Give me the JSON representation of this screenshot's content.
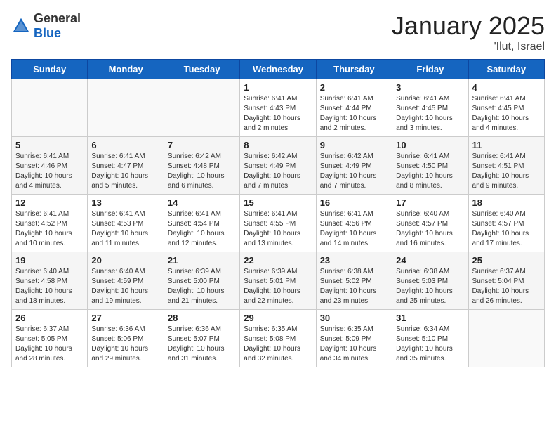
{
  "header": {
    "title": "January 2025",
    "location": "'Ilut, Israel",
    "logo_general": "General",
    "logo_blue": "Blue"
  },
  "days_of_week": [
    "Sunday",
    "Monday",
    "Tuesday",
    "Wednesday",
    "Thursday",
    "Friday",
    "Saturday"
  ],
  "weeks": [
    [
      {
        "day": "",
        "info": ""
      },
      {
        "day": "",
        "info": ""
      },
      {
        "day": "",
        "info": ""
      },
      {
        "day": "1",
        "info": "Sunrise: 6:41 AM\nSunset: 4:43 PM\nDaylight: 10 hours\nand 2 minutes."
      },
      {
        "day": "2",
        "info": "Sunrise: 6:41 AM\nSunset: 4:44 PM\nDaylight: 10 hours\nand 2 minutes."
      },
      {
        "day": "3",
        "info": "Sunrise: 6:41 AM\nSunset: 4:45 PM\nDaylight: 10 hours\nand 3 minutes."
      },
      {
        "day": "4",
        "info": "Sunrise: 6:41 AM\nSunset: 4:45 PM\nDaylight: 10 hours\nand 4 minutes."
      }
    ],
    [
      {
        "day": "5",
        "info": "Sunrise: 6:41 AM\nSunset: 4:46 PM\nDaylight: 10 hours\nand 4 minutes."
      },
      {
        "day": "6",
        "info": "Sunrise: 6:41 AM\nSunset: 4:47 PM\nDaylight: 10 hours\nand 5 minutes."
      },
      {
        "day": "7",
        "info": "Sunrise: 6:42 AM\nSunset: 4:48 PM\nDaylight: 10 hours\nand 6 minutes."
      },
      {
        "day": "8",
        "info": "Sunrise: 6:42 AM\nSunset: 4:49 PM\nDaylight: 10 hours\nand 7 minutes."
      },
      {
        "day": "9",
        "info": "Sunrise: 6:42 AM\nSunset: 4:49 PM\nDaylight: 10 hours\nand 7 minutes."
      },
      {
        "day": "10",
        "info": "Sunrise: 6:41 AM\nSunset: 4:50 PM\nDaylight: 10 hours\nand 8 minutes."
      },
      {
        "day": "11",
        "info": "Sunrise: 6:41 AM\nSunset: 4:51 PM\nDaylight: 10 hours\nand 9 minutes."
      }
    ],
    [
      {
        "day": "12",
        "info": "Sunrise: 6:41 AM\nSunset: 4:52 PM\nDaylight: 10 hours\nand 10 minutes."
      },
      {
        "day": "13",
        "info": "Sunrise: 6:41 AM\nSunset: 4:53 PM\nDaylight: 10 hours\nand 11 minutes."
      },
      {
        "day": "14",
        "info": "Sunrise: 6:41 AM\nSunset: 4:54 PM\nDaylight: 10 hours\nand 12 minutes."
      },
      {
        "day": "15",
        "info": "Sunrise: 6:41 AM\nSunset: 4:55 PM\nDaylight: 10 hours\nand 13 minutes."
      },
      {
        "day": "16",
        "info": "Sunrise: 6:41 AM\nSunset: 4:56 PM\nDaylight: 10 hours\nand 14 minutes."
      },
      {
        "day": "17",
        "info": "Sunrise: 6:40 AM\nSunset: 4:57 PM\nDaylight: 10 hours\nand 16 minutes."
      },
      {
        "day": "18",
        "info": "Sunrise: 6:40 AM\nSunset: 4:57 PM\nDaylight: 10 hours\nand 17 minutes."
      }
    ],
    [
      {
        "day": "19",
        "info": "Sunrise: 6:40 AM\nSunset: 4:58 PM\nDaylight: 10 hours\nand 18 minutes."
      },
      {
        "day": "20",
        "info": "Sunrise: 6:40 AM\nSunset: 4:59 PM\nDaylight: 10 hours\nand 19 minutes."
      },
      {
        "day": "21",
        "info": "Sunrise: 6:39 AM\nSunset: 5:00 PM\nDaylight: 10 hours\nand 21 minutes."
      },
      {
        "day": "22",
        "info": "Sunrise: 6:39 AM\nSunset: 5:01 PM\nDaylight: 10 hours\nand 22 minutes."
      },
      {
        "day": "23",
        "info": "Sunrise: 6:38 AM\nSunset: 5:02 PM\nDaylight: 10 hours\nand 23 minutes."
      },
      {
        "day": "24",
        "info": "Sunrise: 6:38 AM\nSunset: 5:03 PM\nDaylight: 10 hours\nand 25 minutes."
      },
      {
        "day": "25",
        "info": "Sunrise: 6:37 AM\nSunset: 5:04 PM\nDaylight: 10 hours\nand 26 minutes."
      }
    ],
    [
      {
        "day": "26",
        "info": "Sunrise: 6:37 AM\nSunset: 5:05 PM\nDaylight: 10 hours\nand 28 minutes."
      },
      {
        "day": "27",
        "info": "Sunrise: 6:36 AM\nSunset: 5:06 PM\nDaylight: 10 hours\nand 29 minutes."
      },
      {
        "day": "28",
        "info": "Sunrise: 6:36 AM\nSunset: 5:07 PM\nDaylight: 10 hours\nand 31 minutes."
      },
      {
        "day": "29",
        "info": "Sunrise: 6:35 AM\nSunset: 5:08 PM\nDaylight: 10 hours\nand 32 minutes."
      },
      {
        "day": "30",
        "info": "Sunrise: 6:35 AM\nSunset: 5:09 PM\nDaylight: 10 hours\nand 34 minutes."
      },
      {
        "day": "31",
        "info": "Sunrise: 6:34 AM\nSunset: 5:10 PM\nDaylight: 10 hours\nand 35 minutes."
      },
      {
        "day": "",
        "info": ""
      }
    ]
  ]
}
